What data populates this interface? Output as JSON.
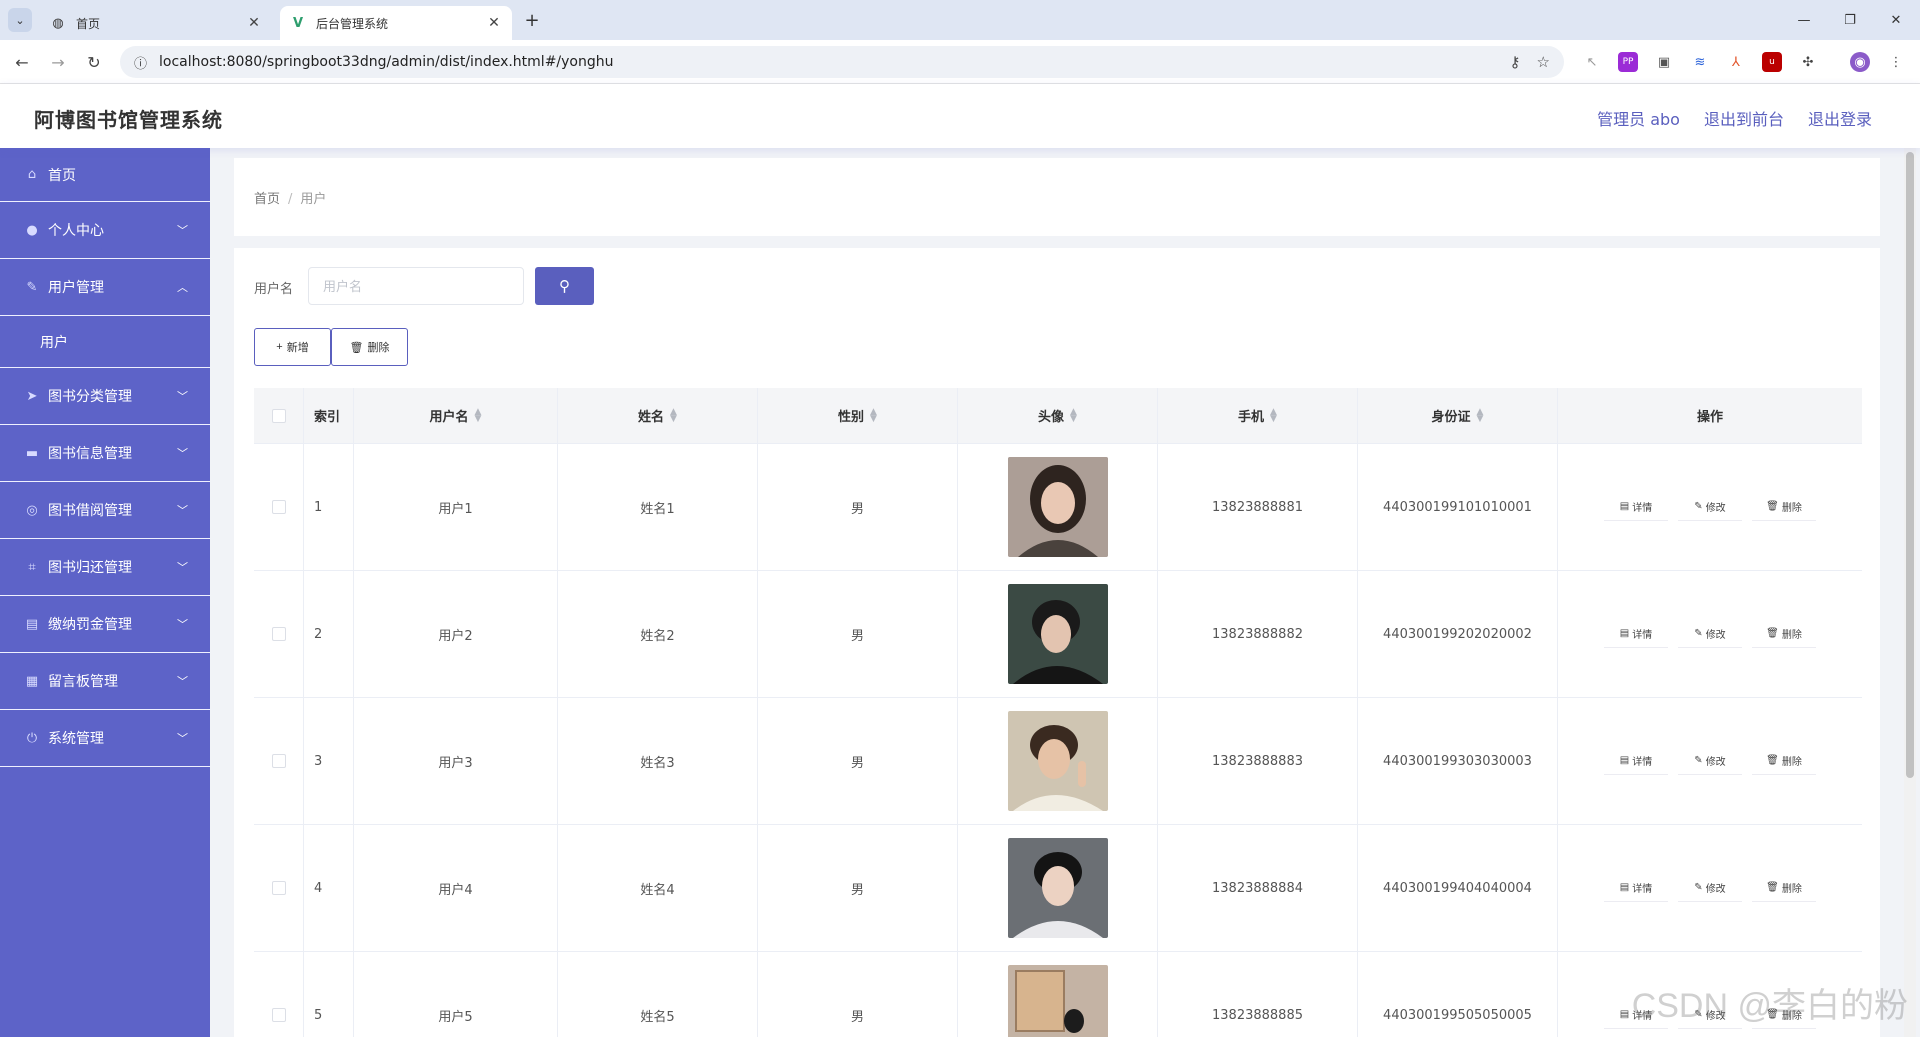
{
  "browser": {
    "tabs": [
      {
        "title": "首页",
        "active": false
      },
      {
        "title": "后台管理系统",
        "active": true
      }
    ],
    "url": "localhost:8080/springboot33dng/admin/dist/index.html#/yonghu"
  },
  "header": {
    "brand": "阿博图书馆管理系统",
    "links": [
      "管理员 abo",
      "退出到前台",
      "退出登录"
    ]
  },
  "sidebar": {
    "items": [
      {
        "label": "首页",
        "icon": "home-icon"
      },
      {
        "label": "个人中心",
        "icon": "user-icon"
      },
      {
        "label": "用户管理",
        "icon": "edit-icon",
        "sub": [
          "用户"
        ]
      },
      {
        "label": "图书分类管理",
        "icon": "send-icon"
      },
      {
        "label": "图书信息管理",
        "icon": "card-icon"
      },
      {
        "label": "图书借阅管理",
        "icon": "globe-icon"
      },
      {
        "label": "图书归还管理",
        "icon": "crop-icon"
      },
      {
        "label": "缴纳罚金管理",
        "icon": "doc-icon"
      },
      {
        "label": "留言板管理",
        "icon": "grid-icon"
      },
      {
        "label": "系统管理",
        "icon": "power-icon"
      }
    ]
  },
  "breadcrumb": {
    "home": "首页",
    "current": "用户"
  },
  "search": {
    "label": "用户名",
    "placeholder": "用户名"
  },
  "actions": {
    "add": "新增",
    "delete": "删除"
  },
  "table": {
    "headers": {
      "index": "索引",
      "username": "用户名",
      "name": "姓名",
      "sex": "性别",
      "avatar": "头像",
      "phone": "手机",
      "idcard": "身份证",
      "ops": "操作"
    },
    "row_ops": {
      "detail": "详情",
      "edit": "修改",
      "delete": "删除"
    },
    "rows": [
      {
        "index": "1",
        "username": "用户1",
        "name": "姓名1",
        "sex": "男",
        "phone": "13823888881",
        "idcard": "440300199101010001"
      },
      {
        "index": "2",
        "username": "用户2",
        "name": "姓名2",
        "sex": "男",
        "phone": "13823888882",
        "idcard": "440300199202020002"
      },
      {
        "index": "3",
        "username": "用户3",
        "name": "姓名3",
        "sex": "男",
        "phone": "13823888883",
        "idcard": "440300199303030003"
      },
      {
        "index": "4",
        "username": "用户4",
        "name": "姓名4",
        "sex": "男",
        "phone": "13823888884",
        "idcard": "440300199404040004"
      },
      {
        "index": "5",
        "username": "用户5",
        "name": "姓名5",
        "sex": "男",
        "phone": "13823888885",
        "idcard": "440300199505050005"
      }
    ]
  },
  "watermark": "CSDN @李白的粉",
  "colors": {
    "sidebar": "#5d63c8",
    "accent": "#5a5fbe"
  }
}
